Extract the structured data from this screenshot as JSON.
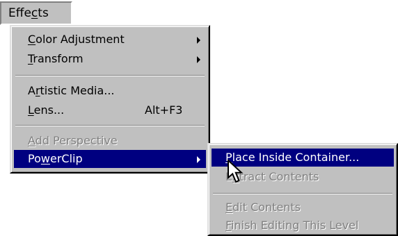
{
  "menubar": {
    "title": {
      "pre": "Effe",
      "mn": "c",
      "post": "ts"
    }
  },
  "effects_menu": {
    "items": [
      {
        "mn": "C",
        "post": "olor Adjustment",
        "submenu": true
      },
      {
        "mn": "T",
        "post": "ransform",
        "submenu": true
      },
      {
        "pre": "A",
        "mn": "r",
        "post": "tistic Media..."
      },
      {
        "mn": "L",
        "post": "ens...",
        "shortcut": "Alt+F3"
      },
      {
        "mn": "A",
        "post": "dd Perspective",
        "disabled": true
      },
      {
        "pre": "Po",
        "mn": "w",
        "post": "erClip",
        "submenu": true,
        "highlighted": true
      }
    ]
  },
  "powerclip_menu": {
    "items": [
      {
        "mn": "P",
        "post": "lace Inside Container...",
        "highlighted": true
      },
      {
        "pre": "E",
        "mn": "x",
        "post": "tract Contents",
        "disabled": true
      },
      {
        "mn": "E",
        "post": "dit Contents",
        "disabled": true
      },
      {
        "mn": "F",
        "post": "inish Editing This Level",
        "disabled": true
      }
    ]
  },
  "icons": {
    "submenu_arrow": "triangle-right-icon",
    "cursor": "arrow-pointer-icon"
  },
  "colors": {
    "menu_face": "#c0c0c0",
    "highlight_bg": "#000080",
    "highlight_text": "#ffffff",
    "disabled_text": "#808080"
  }
}
